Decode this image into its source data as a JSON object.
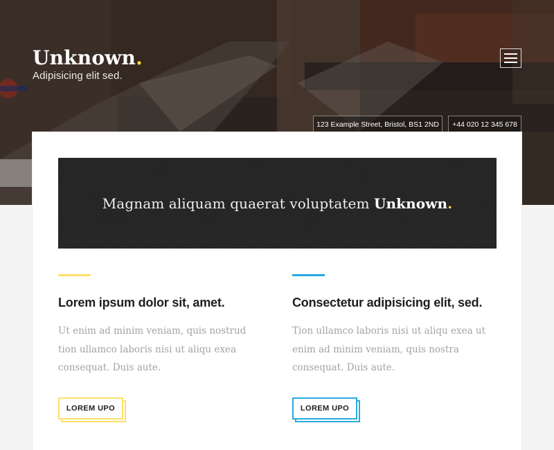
{
  "header": {
    "brand_name": "Unknown",
    "brand_dot": ".",
    "tagline": "Adipisicing elit sed.",
    "menu_icon": "hamburger-menu-icon",
    "address": "123 Example Street, Bristol, BS1 2ND",
    "phone": "+44 020 12 345 678"
  },
  "banner": {
    "text": "Magnam aliquam quaerat voluptatem ",
    "strong": "Unknown",
    "dot": "."
  },
  "features": [
    {
      "title": "Lorem ipsum dolor sit, amet.",
      "body": "Ut enim ad minim veniam, quis nostrud tion ullamco laboris nisi ut aliqu exea consequat. Duis aute.",
      "button": "LOREM UPO",
      "accent": "#ffe066"
    },
    {
      "title": "Consectetur adipisicing elit, sed.",
      "body": "Tion ullamco laboris nisi ut aliqu exea ut enim ad minim veniam, quis nostra consequat. Duis aute.",
      "button": "LOREM UPO",
      "accent": "#27a9e1"
    }
  ],
  "colors": {
    "yellow": "#ffe066",
    "blue": "#27a9e1",
    "banner_bg": "#262626"
  }
}
